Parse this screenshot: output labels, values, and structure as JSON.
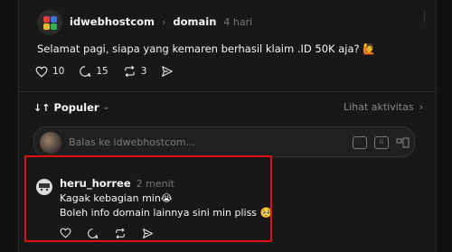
{
  "post": {
    "author": "idwebhostcom",
    "separator": "›",
    "topic": "domain",
    "time": "4 hari",
    "text": "Selamat pagi, siapa yang kemaren berhasil klaim .ID 50K aja? 🙋",
    "likes": "10",
    "comments": "15",
    "reposts": "3"
  },
  "thread": {
    "sort_label": "Populer",
    "activity_label": "Lihat aktivitas"
  },
  "reply_box": {
    "placeholder": "Balas ke idwebhostcom..."
  },
  "comment": {
    "author": "heru_horree",
    "time": "2 menit",
    "line1": "Kagak kebagian min😭",
    "line2": "Boleh info domain lainnya sini min pliss 🥺"
  },
  "colors": {
    "highlight": "#e01010",
    "background": "#181818"
  }
}
